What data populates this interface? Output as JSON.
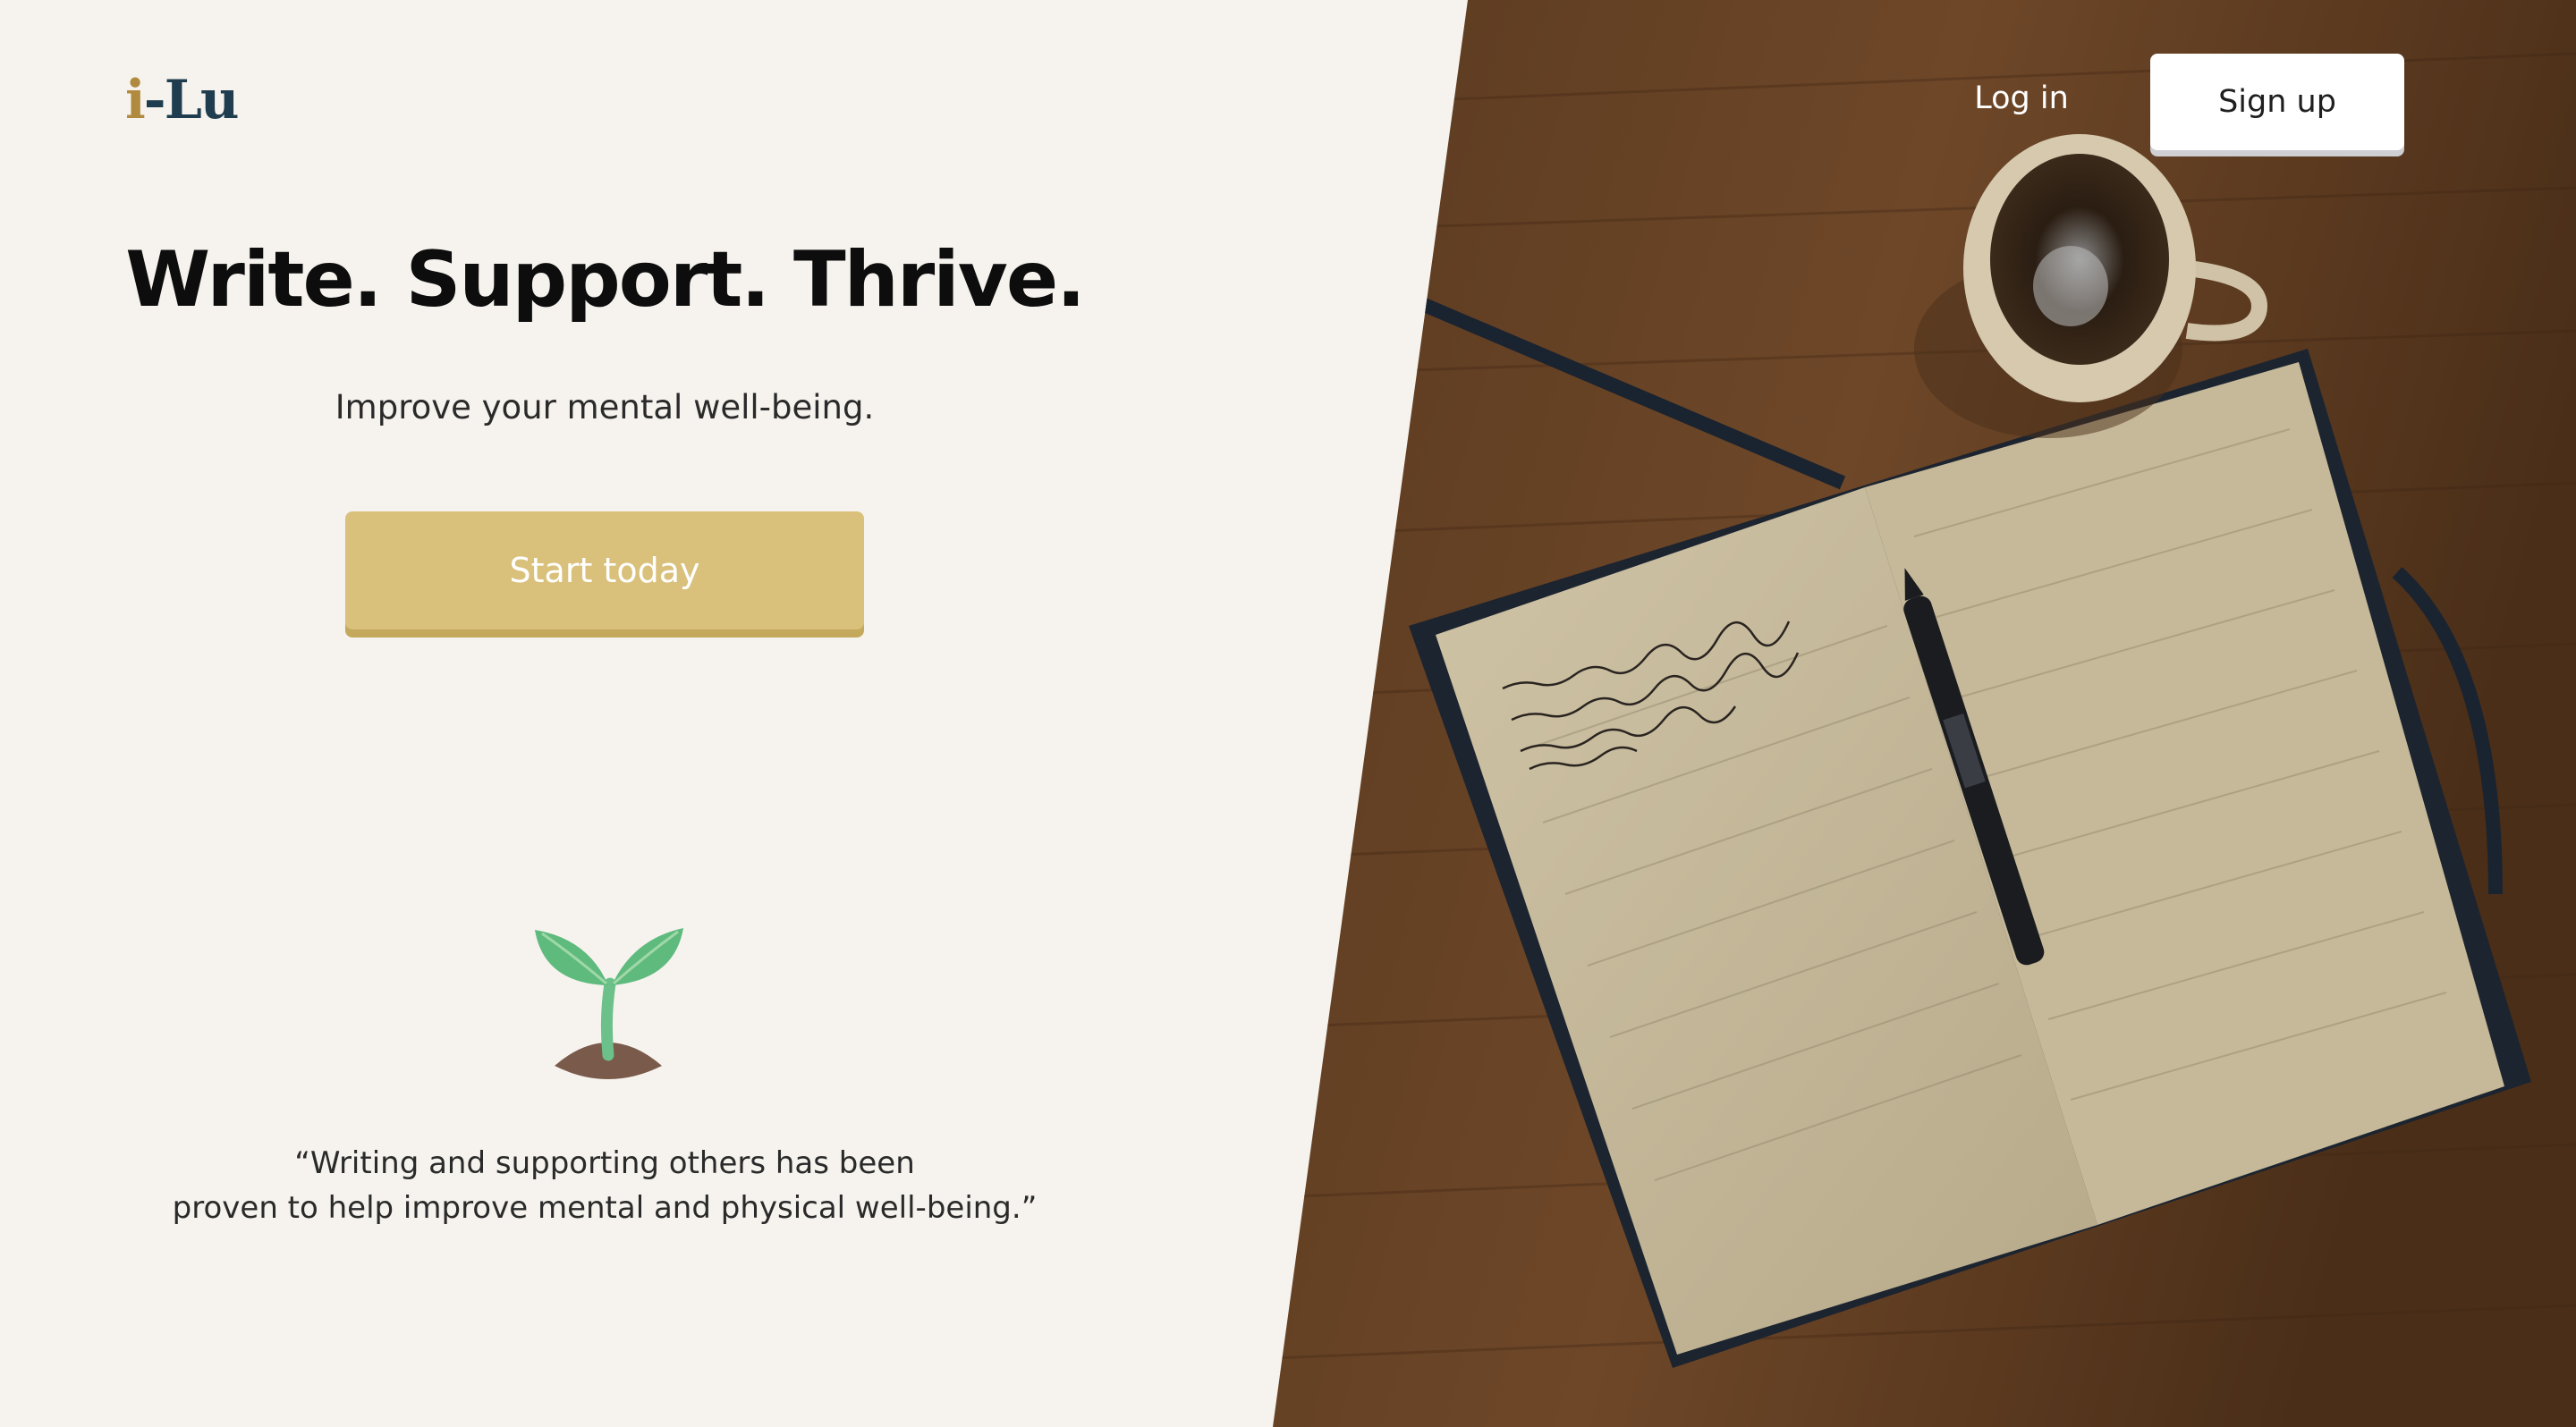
{
  "brand": {
    "logo_i": "i",
    "logo_rest": "-Lu"
  },
  "nav": {
    "login_label": "Log in",
    "signup_label": "Sign up"
  },
  "hero": {
    "title": "Write. Support. Thrive.",
    "subtitle": "Improve your mental well-being.",
    "cta_label": "Start today"
  },
  "quote": {
    "line1": "“Writing and supporting others has been",
    "line2": "proven to help improve mental and physical well-being.”"
  },
  "illustration": {
    "icon": "sprout-icon"
  },
  "colors": {
    "background": "#f6f3ee",
    "accent": "#d9c07b",
    "logo_dark": "#1f3d4f",
    "logo_gold": "#b08a3e"
  }
}
